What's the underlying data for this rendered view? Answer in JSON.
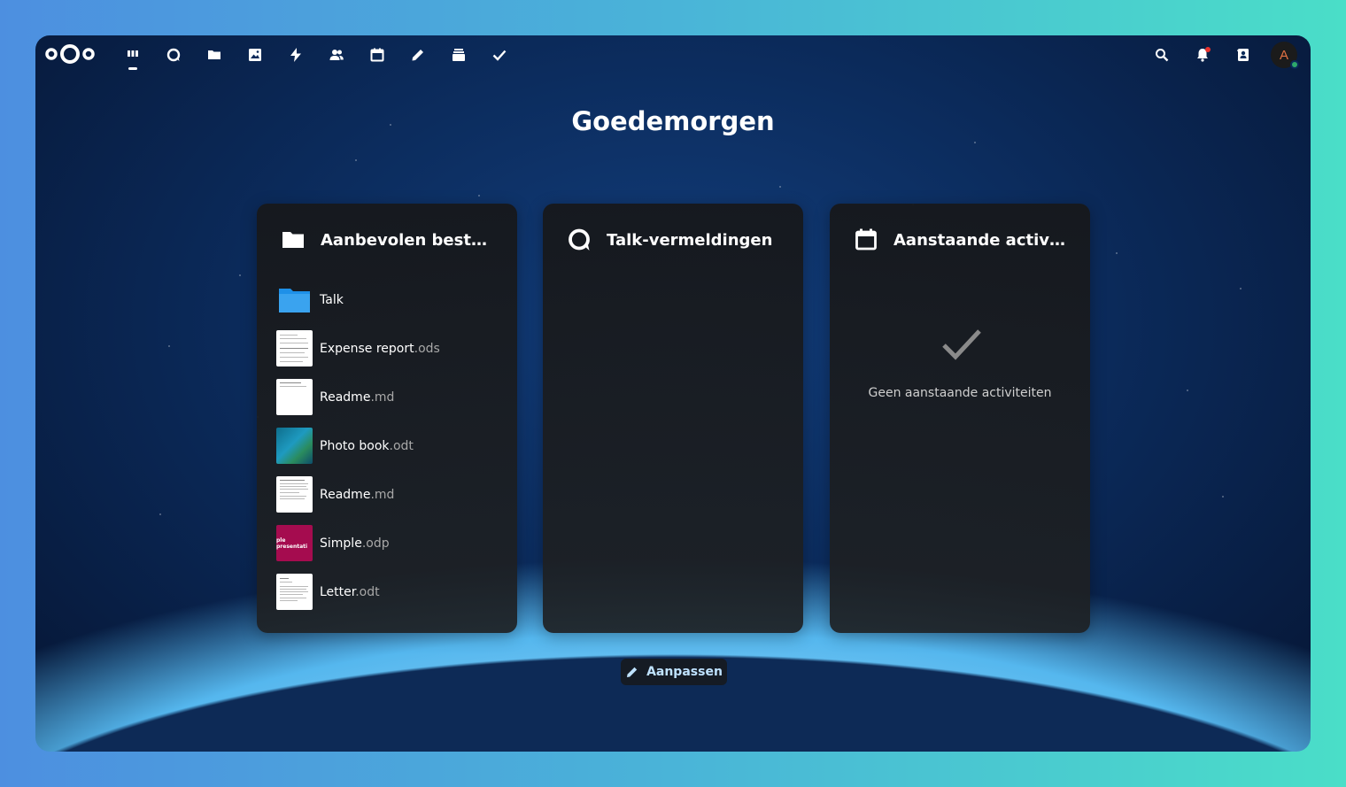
{
  "topbar": {
    "logo": "nextcloud-logo",
    "apps": [
      {
        "name": "dashboard",
        "icon": "dashboard-icon",
        "active": true
      },
      {
        "name": "talk",
        "icon": "talk-icon"
      },
      {
        "name": "files",
        "icon": "folder-icon"
      },
      {
        "name": "photos",
        "icon": "image-icon"
      },
      {
        "name": "activity",
        "icon": "lightning-icon"
      },
      {
        "name": "contacts",
        "icon": "contacts-icon"
      },
      {
        "name": "calendar",
        "icon": "calendar-icon"
      },
      {
        "name": "notes",
        "icon": "pencil-icon"
      },
      {
        "name": "deck",
        "icon": "deck-icon"
      },
      {
        "name": "tasks",
        "icon": "checkmark-icon"
      }
    ],
    "right": {
      "search_icon": "search-icon",
      "notifications_icon": "bell-icon",
      "contacts_menu_icon": "contacts-menu-icon",
      "avatar_initial": "A"
    }
  },
  "greeting": "Goedemorgen",
  "widgets": {
    "recommended": {
      "title": "Aanbevolen bestan…",
      "files": [
        {
          "base": "Talk",
          "ext": "",
          "kind": "folder"
        },
        {
          "base": "Expense report",
          "ext": ".ods",
          "kind": "doc"
        },
        {
          "base": "Readme",
          "ext": ".md",
          "kind": "doc"
        },
        {
          "base": "Photo book",
          "ext": ".odt",
          "kind": "photo"
        },
        {
          "base": "Readme",
          "ext": ".md",
          "kind": "doc"
        },
        {
          "base": "Simple",
          "ext": ".odp",
          "kind": "presentation"
        },
        {
          "base": "Letter",
          "ext": ".odt",
          "kind": "doc"
        }
      ],
      "presentation_thumb_text": "ple presentati"
    },
    "talk": {
      "title": "Talk-vermeldingen"
    },
    "upcoming": {
      "title": "Aanstaande activite…",
      "empty_text": "Geen aanstaande activiteiten"
    }
  },
  "customize_label": "Aanpassen",
  "colors": {
    "folder_blue": "#1e90e8",
    "presentation": "#a50c4f",
    "status_online": "#2ea86b",
    "notification": "#e9322d"
  }
}
